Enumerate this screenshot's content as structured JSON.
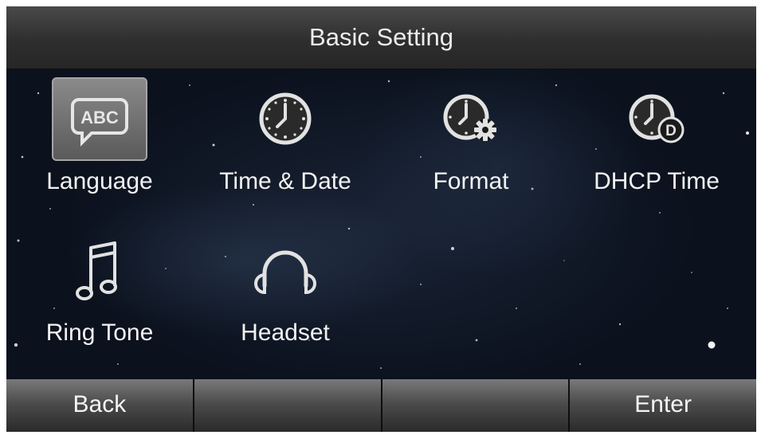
{
  "title": "Basic Setting",
  "menu": [
    {
      "label": "Language",
      "icon": "language-abc-icon",
      "selected": true
    },
    {
      "label": "Time & Date",
      "icon": "clock-icon",
      "selected": false
    },
    {
      "label": "Format",
      "icon": "clock-gear-icon",
      "selected": false
    },
    {
      "label": "DHCP Time",
      "icon": "clock-dhcp-icon",
      "selected": false
    },
    {
      "label": "Ring Tone",
      "icon": "music-note-icon",
      "selected": false
    },
    {
      "label": "Headset",
      "icon": "headset-icon",
      "selected": false
    }
  ],
  "softkeys": [
    "Back",
    "",
    "",
    "Enter"
  ],
  "icon_text": {
    "language": "ABC",
    "dhcp_badge": "D"
  },
  "colors": {
    "selection_bg": "#6e6e6e",
    "text": "#f2f2f2",
    "background": "#0b111d"
  }
}
